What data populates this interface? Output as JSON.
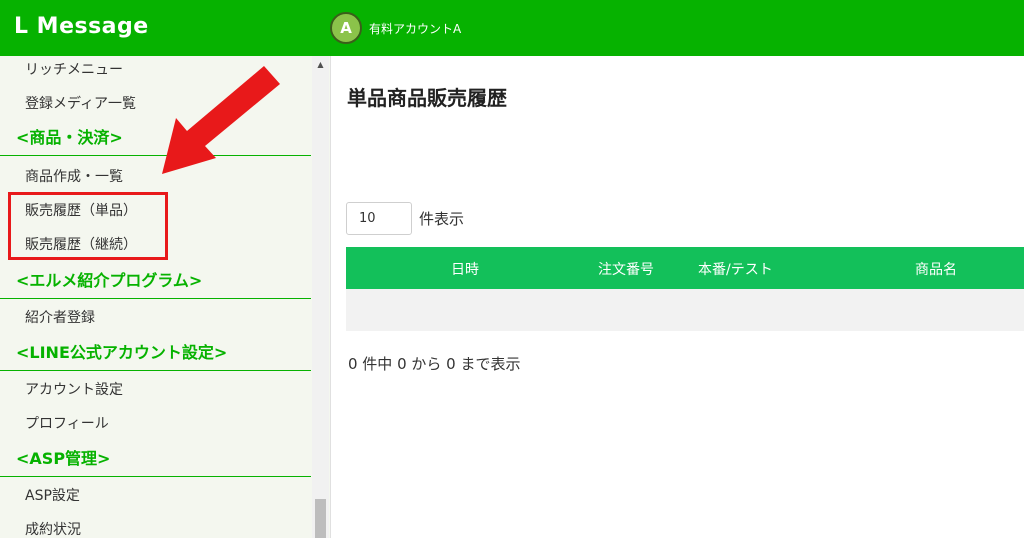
{
  "header": {
    "brand": "L Message",
    "account": {
      "avatar_letter": "A",
      "name": "有料アカウントA"
    }
  },
  "sidebar": {
    "items": [
      {
        "type": "item",
        "label": "リッチメニュー"
      },
      {
        "type": "item",
        "label": "登録メディア一覧"
      },
      {
        "type": "section",
        "label": "<商品・決済>"
      },
      {
        "type": "item",
        "label": "商品作成・一覧"
      },
      {
        "type": "item",
        "label": "販売履歴（単品）"
      },
      {
        "type": "item",
        "label": "販売履歴（継続）"
      },
      {
        "type": "section",
        "label": "<エルメ紹介プログラム>"
      },
      {
        "type": "item",
        "label": "紹介者登録"
      },
      {
        "type": "section",
        "label": "<LINE公式アカウント設定>"
      },
      {
        "type": "item",
        "label": "アカウント設定"
      },
      {
        "type": "item",
        "label": "プロフィール"
      },
      {
        "type": "section",
        "label": "<ASP管理>"
      },
      {
        "type": "item",
        "label": "ASP設定"
      },
      {
        "type": "item",
        "label": "成約状況"
      }
    ]
  },
  "main": {
    "title": "単品商品販売履歴",
    "length": {
      "value": "10",
      "label": "件表示"
    },
    "table": {
      "columns": [
        "日時",
        "注文番号",
        "本番/テスト",
        "商品名"
      ],
      "rows": []
    },
    "info": "0 件中 0 から 0 まで表示"
  },
  "colors": {
    "header_bg": "#06b200",
    "sidebar_bg": "#f4f7ef",
    "section_text": "#06b200",
    "table_header_bg": "#13c05a",
    "annotation_red": "#e8191a"
  },
  "icons": {
    "avatar": "letter-avatar",
    "scroll_up": "triangle-up-icon",
    "annotation_arrow": "red-arrow-icon"
  }
}
